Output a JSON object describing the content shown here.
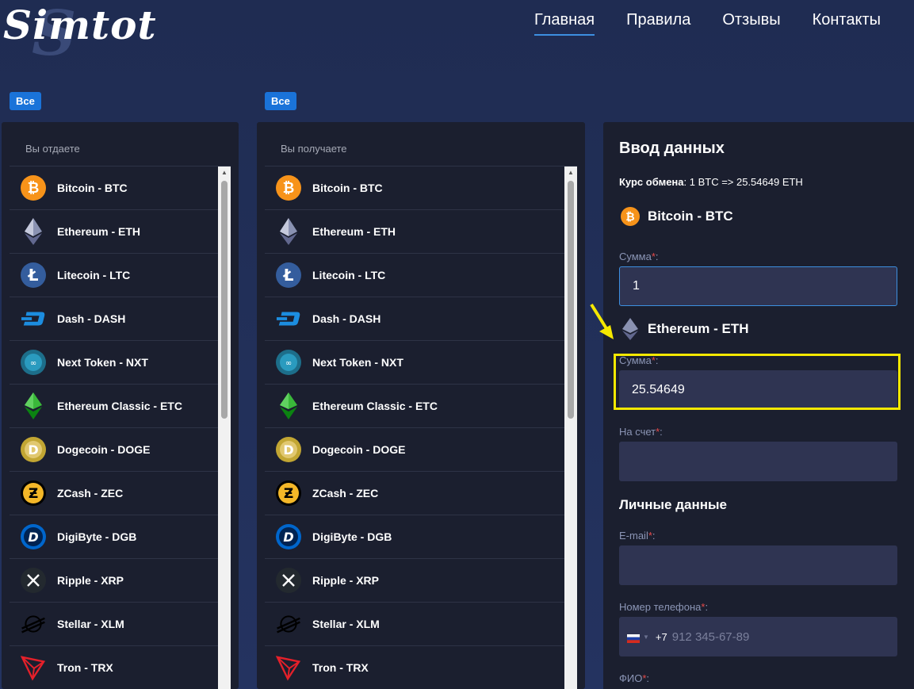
{
  "logo": {
    "text": "Simtot",
    "letter": "S"
  },
  "nav": [
    {
      "label": "Главная",
      "active": true
    },
    {
      "label": "Правила",
      "active": false
    },
    {
      "label": "Отзывы",
      "active": false
    },
    {
      "label": "Контакты",
      "active": false
    }
  ],
  "filters": {
    "all_label_give": "Все",
    "all_label_get": "Все"
  },
  "give_panel": {
    "title": "Вы отдаете"
  },
  "get_panel": {
    "title": "Вы получаете"
  },
  "currencies": [
    {
      "label": "Bitcoin - BTC",
      "icon": "bitcoin-icon"
    },
    {
      "label": "Ethereum - ETH",
      "icon": "ethereum-icon"
    },
    {
      "label": "Litecoin - LTC",
      "icon": "litecoin-icon"
    },
    {
      "label": "Dash - DASH",
      "icon": "dash-icon"
    },
    {
      "label": "Next Token - NXT",
      "icon": "nxt-icon"
    },
    {
      "label": "Ethereum Classic - ETC",
      "icon": "ethereum-classic-icon"
    },
    {
      "label": "Dogecoin - DOGE",
      "icon": "dogecoin-icon"
    },
    {
      "label": "ZCash - ZEC",
      "icon": "zcash-icon"
    },
    {
      "label": "DigiByte - DGB",
      "icon": "digibyte-icon"
    },
    {
      "label": "Ripple - XRP",
      "icon": "ripple-icon"
    },
    {
      "label": "Stellar - XLM",
      "icon": "stellar-icon"
    },
    {
      "label": "Tron - TRX",
      "icon": "tron-icon"
    }
  ],
  "form": {
    "title": "Ввод данных",
    "rate_label": "Курс обмена",
    "rate_value": ": 1 BTC => 25.54649 ETH",
    "give_currency": "Bitcoin - BTC",
    "give_amount_label": "Сумма",
    "give_amount_value": "1",
    "get_currency": "Ethereum - ETH",
    "get_amount_label": "Сумма",
    "get_amount_value": "25.54649",
    "account_label": "На счет",
    "account_value": "",
    "personal_title": "Личные данные",
    "email_label": "E-mail",
    "email_value": "",
    "phone_label": "Номер телефона",
    "phone_code": "+7",
    "phone_placeholder": "912 345-67-89",
    "fio_label": "ФИО",
    "required_mark": "*",
    "label_colon": ":"
  },
  "colors": {
    "accent": "#1a73d9",
    "highlight": "#f5e800",
    "panel": "#1b1f2f",
    "field": "#2f3452"
  }
}
